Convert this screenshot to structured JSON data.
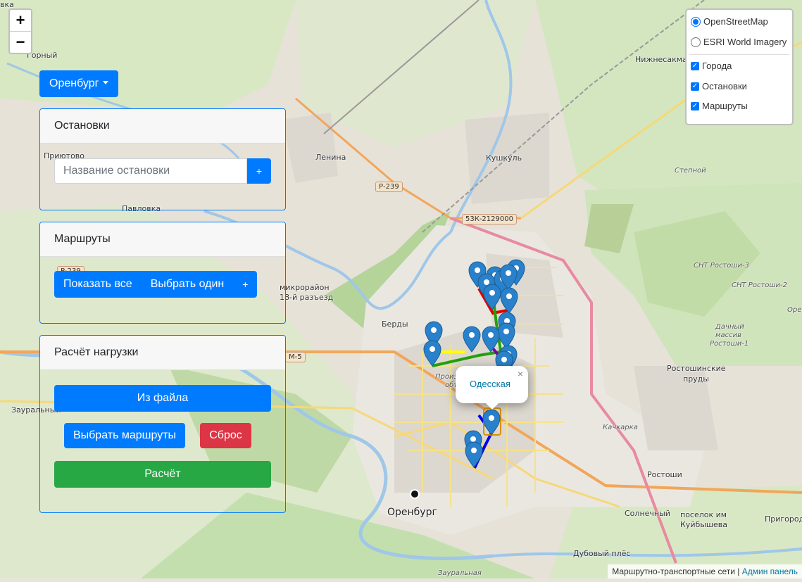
{
  "zoom": {
    "in_label": "+",
    "out_label": "−"
  },
  "city_selector": {
    "label": "Оренбург"
  },
  "stops_panel": {
    "title": "Остановки",
    "search_placeholder": "Название остановки",
    "add_label": "+"
  },
  "routes_panel": {
    "title": "Маршруты",
    "show_all_label": "Показать все",
    "choose_one_label": "Выбрать один",
    "add_label": "+"
  },
  "load_panel": {
    "title": "Расчёт нагрузки",
    "from_file_label": "Из файла",
    "select_routes_label": "Выбрать маршруты",
    "reset_label": "Сброс",
    "calculate_label": "Расчёт"
  },
  "layers": {
    "base": [
      {
        "label": "OpenStreetMap",
        "checked": true
      },
      {
        "label": "ESRI World Imagery",
        "checked": false
      }
    ],
    "overlays": [
      {
        "label": "Города",
        "checked": true
      },
      {
        "label": "Остановки",
        "checked": true
      },
      {
        "label": "Маршруты",
        "checked": true
      }
    ]
  },
  "popup": {
    "stop_name": "Одесская",
    "close_label": "×"
  },
  "attribution": {
    "text": "Маршрутно-транспортные сети |",
    "link": "Админ панель"
  },
  "map_labels": {
    "gorny": "Горный",
    "pridorozhny": "Приютово",
    "pavlovka": "Павловка",
    "lenina": "Ленина",
    "kushkul": "Кушкуль",
    "nizhnesakmar": "Нижнесакмарский",
    "stepnoy": "Степной",
    "mikro": "микрорайон",
    "razezd": "18-й разъезд",
    "berdy": "Берды",
    "zauralny": "Зауральный",
    "orenburg": "Оренбург",
    "rostoshi_pr": "Ростошинские",
    "prudy": "пруды",
    "rostoshi": "Ростоши",
    "solnechny": "Солнечный",
    "poselok": "поселок им",
    "kuibysheva": "Куйбышева",
    "prigorod": "Пригород",
    "dubovy": "Дубовый плёс",
    "kachkarka": "Качкарка",
    "snt3": "СНТ Ростоши-3",
    "snt2": "СНТ Ростоши-2",
    "dachny1": "Дачный",
    "dachny2": "массив",
    "dachny3": "Ростоши-1",
    "zauralnaya": "Зауральная",
    "vka": "вка",
    "ore": "Оре",
    "prom1": "Произ",
    "prom2": "объ",
    "shield_r239": "Р-239",
    "shield_53k": "53К-2129000",
    "shield_m5": "М-5",
    "shield_p239b": "Р-239"
  },
  "colors": {
    "primary": "#007bff",
    "danger": "#dc3545",
    "success": "#28a745",
    "route_green": "#22a00a",
    "route_red": "#e00000",
    "route_blue": "#0000ee",
    "route_yellow": "#ffff00",
    "route_purple": "#7a00a8",
    "marker": "#2a81cb"
  }
}
